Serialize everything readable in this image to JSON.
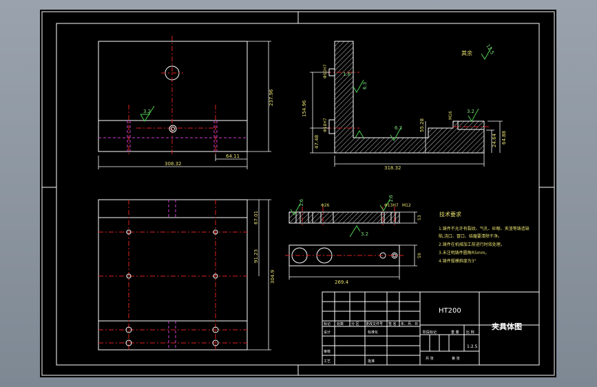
{
  "drawing": {
    "material": "HT200",
    "title": "夹具体图",
    "scale": "1:2.5",
    "remaining_roughness": "其余",
    "remaining_roughness_value": "12.5"
  },
  "tech_requirements": {
    "title": "技术要求",
    "lines": [
      "1.铸件不允许有裂纹、气孔、砂眼、夹渣等铸造缺",
      "陷,浇口、冒口、结瘤要清除干净。",
      "2.铸件在机械加工前进行时效处理。",
      "3.未注明铸件圆角R5mm。",
      "4.铸件拔模斜度为3°"
    ]
  },
  "dimensions": {
    "front_width": "308.32",
    "front_offset": "64.11",
    "front_height": "237.96",
    "side_width": "318.32",
    "side_h1": "154.96",
    "side_h2": "47.48",
    "side_h3": "55.28",
    "side_h4": "24.64",
    "side_h5": "64.88",
    "side_r1": "Φ50H7",
    "side_r2": "Φ18H7",
    "side_r3": "M16",
    "plan_v1": "67.01",
    "plan_v2": "91.23",
    "plan_v3": "304.9",
    "detail_width": "269.4",
    "detail_thk": "53",
    "detail_h": "59",
    "detail_c1": "Φ26",
    "detail_c2": "Φ13H7",
    "detail_c3": "M12"
  },
  "roughness": {
    "r1": "3.2",
    "r2": "1.6",
    "r3": "6.3",
    "r4": "6.3",
    "r5": "3.2",
    "r6": "1.6",
    "r7": "1.6",
    "r8": "3.2"
  },
  "title_block": {
    "col_mark": "标记",
    "col_count": "处数",
    "col_zone": "分 区",
    "col_docno": "更改文件号",
    "col_sign": "签 名",
    "col_date": "年、月、日",
    "row_design": "设计",
    "row_std": "标准化",
    "row_review": "审核",
    "row_process": "工艺",
    "row_approve": "批准",
    "stage_mark": "阶段标记",
    "weight": "重 量",
    "scale_label": "比 例",
    "sheets_total": "共  张",
    "sheet_no": "第  张"
  }
}
